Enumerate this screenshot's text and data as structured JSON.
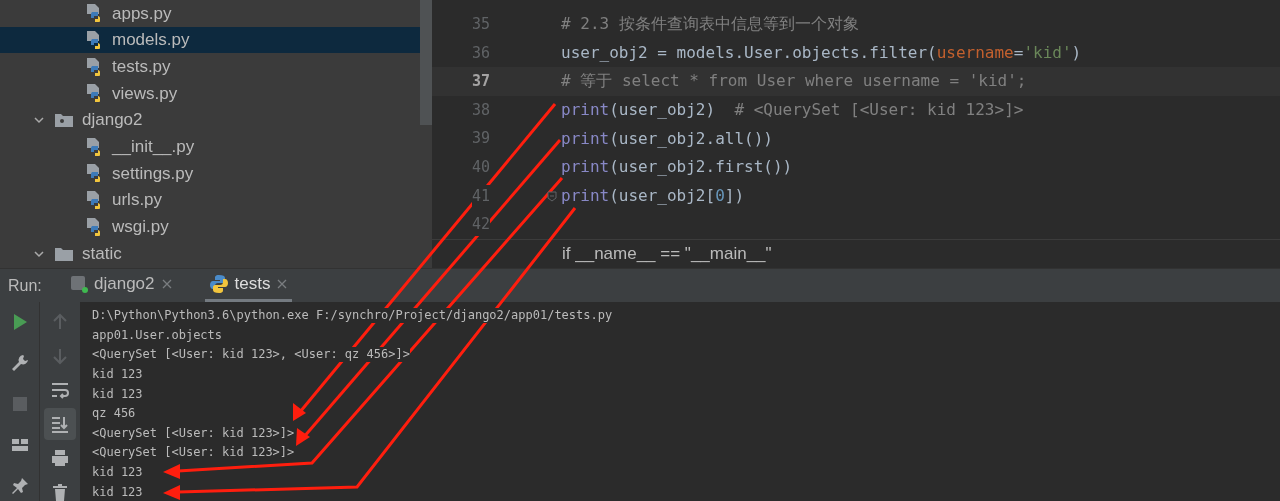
{
  "project_tree": [
    {
      "label": "apps.py",
      "kind": "file",
      "selected": false
    },
    {
      "label": "models.py",
      "kind": "file",
      "selected": true
    },
    {
      "label": "tests.py",
      "kind": "file",
      "selected": false
    },
    {
      "label": "views.py",
      "kind": "file",
      "selected": false
    },
    {
      "label": "django2",
      "kind": "package",
      "selected": false,
      "expanded": true,
      "children": [
        {
          "label": "__init__.py",
          "kind": "file",
          "selected": false
        },
        {
          "label": "settings.py",
          "kind": "file",
          "selected": false
        },
        {
          "label": "urls.py",
          "kind": "file",
          "selected": false
        },
        {
          "label": "wsgi.py",
          "kind": "file",
          "selected": false
        }
      ]
    },
    {
      "label": "static",
      "kind": "folder",
      "selected": false,
      "expanded": true
    }
  ],
  "editor": {
    "lines": [
      {
        "number": "35",
        "current": false,
        "code": [
          {
            "text": "# 2.3 按条件查询表中信息等到一个对象",
            "kind": "comment"
          }
        ]
      },
      {
        "number": "36",
        "current": false,
        "code": [
          {
            "text": "user_obj2 = models.User.objects.filter(",
            "kind": "plain"
          },
          {
            "text": "username",
            "kind": "param"
          },
          {
            "text": "=",
            "kind": "plain"
          },
          {
            "text": "'kid'",
            "kind": "string"
          },
          {
            "text": ")",
            "kind": "plain"
          }
        ]
      },
      {
        "number": "37",
        "current": true,
        "code": [
          {
            "text": "# 等于 select * from User where username = 'kid';",
            "kind": "comment"
          }
        ]
      },
      {
        "number": "38",
        "current": false,
        "code": [
          {
            "text": "print",
            "kind": "builtin"
          },
          {
            "text": "(user_obj2)  ",
            "kind": "plain"
          },
          {
            "text": "# <QuerySet [<User: kid 123>]>",
            "kind": "comment"
          }
        ]
      },
      {
        "number": "39",
        "current": false,
        "code": [
          {
            "text": "print",
            "kind": "builtin"
          },
          {
            "text": "(user_obj2.all())",
            "kind": "plain"
          }
        ]
      },
      {
        "number": "40",
        "current": false,
        "code": [
          {
            "text": "print",
            "kind": "builtin"
          },
          {
            "text": "(user_obj2.first())",
            "kind": "plain"
          }
        ]
      },
      {
        "number": "41",
        "current": false,
        "fold": true,
        "code": [
          {
            "text": "print",
            "kind": "builtin"
          },
          {
            "text": "(user_obj2[",
            "kind": "plain"
          },
          {
            "text": "0",
            "kind": "number"
          },
          {
            "text": "])",
            "kind": "plain"
          }
        ]
      },
      {
        "number": "42",
        "current": false
      }
    ],
    "sticky_line": "if __name__ == \"__main__\""
  },
  "run": {
    "label": "Run:",
    "tabs": [
      {
        "label": "django2",
        "kind": "django",
        "selected": false
      },
      {
        "label": "tests",
        "kind": "python",
        "selected": true
      }
    ],
    "left_tools": [
      {
        "kind": "run",
        "disabled": false
      },
      {
        "kind": "wrench",
        "disabled": false
      },
      {
        "kind": "stop",
        "disabled": true
      },
      {
        "kind": "layout",
        "disabled": false
      },
      {
        "kind": "pin",
        "disabled": false
      }
    ],
    "right_tools": [
      {
        "kind": "up",
        "disabled": true,
        "selected": false
      },
      {
        "kind": "down",
        "disabled": true,
        "selected": false
      },
      {
        "kind": "wrap",
        "disabled": false,
        "selected": false
      },
      {
        "kind": "scroll-end",
        "disabled": false,
        "selected": true
      },
      {
        "kind": "print",
        "disabled": false,
        "selected": false
      },
      {
        "kind": "trash",
        "disabled": false,
        "selected": false
      }
    ],
    "output": [
      "D:\\Python\\Python3.6\\python.exe F:/synchro/Project/django2/app01/tests.py",
      "app01.User.objects",
      "<QuerySet [<User: kid 123>, <User: qz 456>]>",
      "kid 123",
      "kid 123",
      "qz 456",
      "<QuerySet [<User: kid 123>]>",
      "<QuerySet [<User: kid 123>]>",
      "kid 123",
      "kid 123"
    ]
  }
}
